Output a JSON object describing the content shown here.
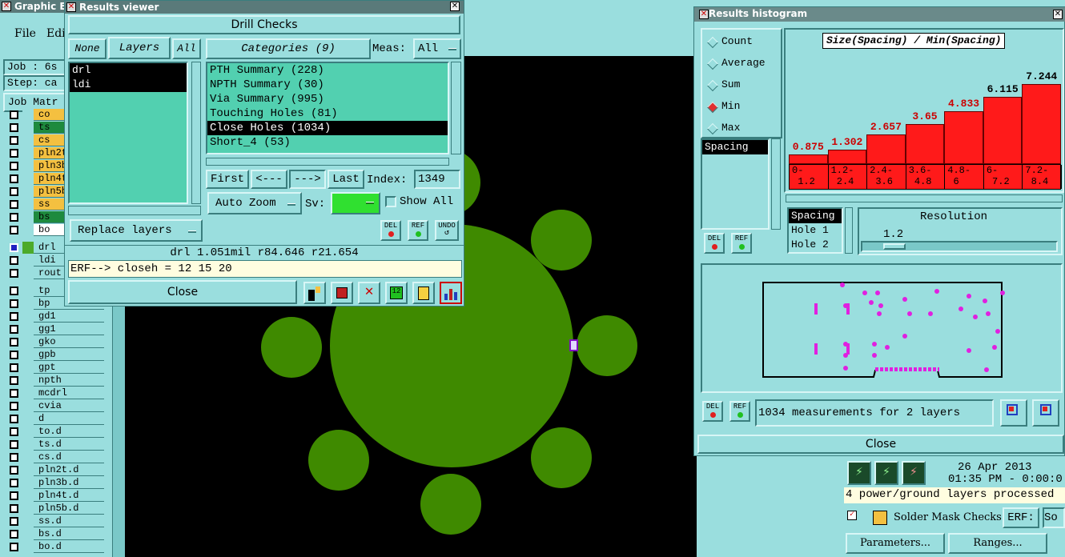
{
  "graphic_editor": {
    "title": "Graphic Ed",
    "menu": [
      "File",
      "Edi"
    ],
    "job": "Job : 6s",
    "step": "Step: ca",
    "job_matrix": "Job Matr",
    "layers_top": [
      {
        "name": "co",
        "color": "#f4c040"
      },
      {
        "name": "ts",
        "color": "#1e8a3e"
      },
      {
        "name": "cs",
        "color": "#f4c040"
      },
      {
        "name": "pln2t",
        "color": "#f4c040"
      },
      {
        "name": "pln3b",
        "color": "#f4c040"
      },
      {
        "name": "pln4t",
        "color": "#f4c040"
      },
      {
        "name": "pln5b",
        "color": "#f4c040"
      },
      {
        "name": "ss",
        "color": "#f4c040"
      },
      {
        "name": "bs",
        "color": "#1e8a3e"
      },
      {
        "name": "bo",
        "color": "#ffffff"
      }
    ],
    "layers_drill": [
      "drl",
      "ldi",
      "rout"
    ],
    "layers_bottom": [
      "tp",
      "bp",
      "gd1",
      "gg1",
      "gko",
      "gpb",
      "gpt",
      "npth",
      "mcdrl",
      "cvia",
      "d",
      "to.d",
      "ts.d",
      "cs.d",
      "pln2t.d",
      "pln3b.d",
      "pln4t.d",
      "pln5b.d",
      "ss.d",
      "bs.d",
      "bo.d"
    ]
  },
  "results_viewer": {
    "title": "Results viewer",
    "header": "Drill Checks",
    "none_btn": "None",
    "layers_btn": "Layers",
    "all_btn": "All",
    "layer_list": [
      "drl",
      "ldi"
    ],
    "categories_btn": "Categories (9)",
    "meas_label": "Meas:",
    "meas_value": "All",
    "categories": [
      {
        "label": "PTH Summary (228)",
        "selected": false
      },
      {
        "label": "NPTH Summary (30)",
        "selected": false
      },
      {
        "label": "Via Summary (995)",
        "selected": false
      },
      {
        "label": "Touching Holes (81)",
        "selected": false
      },
      {
        "label": "Close Holes (1034)",
        "selected": true
      },
      {
        "label": "Short_4 (53)",
        "selected": false
      }
    ],
    "first_btn": "First",
    "prev_btn": "<---",
    "next_btn": "--->",
    "last_btn": "Last",
    "index_label": "Index:",
    "index_value": "1349",
    "auto_zoom": "Auto Zoom",
    "sv_label": "Sv:",
    "show_all": "Show All",
    "replace_layers": "Replace layers",
    "del": "DEL",
    "ref": "REF",
    "undo": "UNDO",
    "status": "drl 1.051mil  r84.646  r21.654",
    "erf": "ERF--> closeh = 12 15 20",
    "close": "Close"
  },
  "histogram": {
    "title": "Results histogram",
    "options": [
      {
        "label": "Count",
        "on": false
      },
      {
        "label": "Average",
        "on": false
      },
      {
        "label": "Sum",
        "on": false
      },
      {
        "label": "Min",
        "on": true
      },
      {
        "label": "Max",
        "on": false
      }
    ],
    "chart_title": "Size(Spacing) / Min(Spacing)",
    "spacing_list": [
      "Spacing"
    ],
    "bins": [
      "0-\n 1.2",
      "1.2-\n 2.4",
      "2.4-\n 3.6",
      "3.6-\n 4.8",
      "4.8-\n 6",
      "6-\n 7.2",
      "7.2-\n 8.4"
    ],
    "values": [
      "0.875",
      "1.302",
      "2.657",
      "3.65",
      "4.833",
      "6.115",
      "7.244"
    ],
    "value_nums": [
      0.875,
      1.302,
      2.657,
      3.65,
      4.833,
      6.115,
      7.244
    ],
    "axis_list": [
      "Spacing",
      "Hole 1",
      "Hole 2"
    ],
    "resolution_label": "Resolution",
    "resolution_value": "1.2",
    "measurements": "1034 measurements for 2 layers",
    "close": "Close",
    "del": "DEL",
    "ref": "REF"
  },
  "drill_panel": {
    "date": "26 Apr 2013",
    "time": "01:35 PM - 0:00:0",
    "message": "4 power/ground layers processed",
    "check_name": "Solder Mask Checks",
    "erf_label": "ERF:",
    "erf_value": "So",
    "parameters": "Parameters...",
    "ranges": "Ranges..."
  },
  "colors": {
    "pad": "#3f8a00",
    "panel": "#9adede",
    "list": "#52d0b0",
    "bar": "#ff1a1a"
  }
}
